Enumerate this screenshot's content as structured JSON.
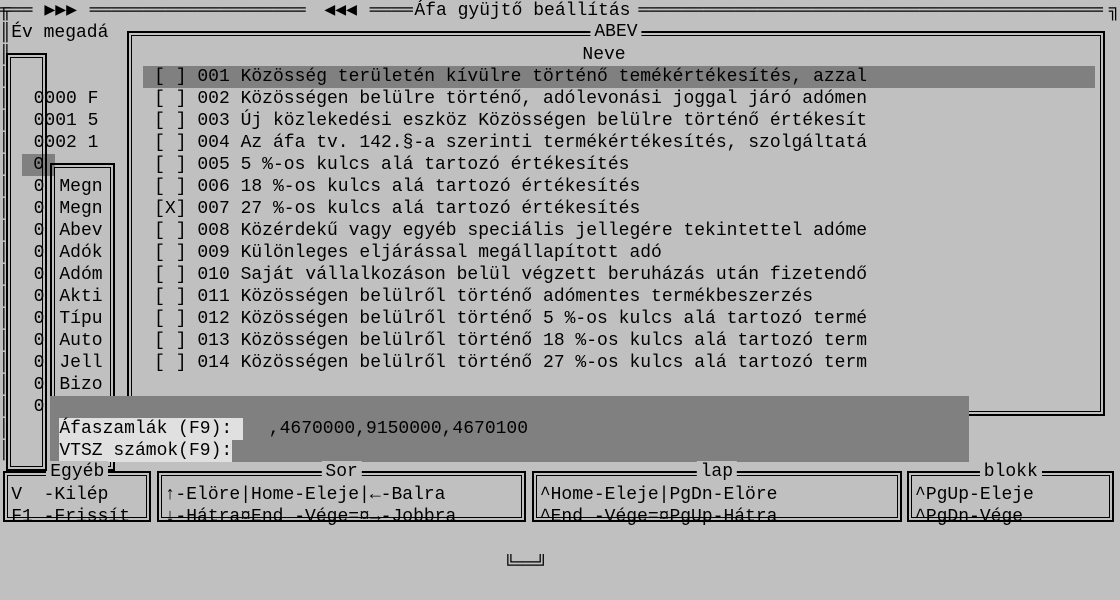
{
  "title_arrows_left": "▶▶▶",
  "title_arrows_right": "◀◀◀",
  "title_main": "Áfa gyüjtő beállítás",
  "field_label": "Év megadá",
  "abev_title": "ABEV",
  "neve_label": "Neve",
  "left_codes": [
    "0000 F",
    "0001 5",
    "0002 1"
  ],
  "left_highlight": "0",
  "left_zeros_count": 11,
  "mid_labels": [
    "Megn",
    "Megn",
    "Abev",
    "Adók",
    "Adóm",
    "Akti",
    "Típu",
    "Auto",
    "Jell",
    "Bizo"
  ],
  "afaszamlak_label": "Áfaszamlák (F9): ",
  "afaszamlak_value": ",4670000,9150000,4670100",
  "vtsz_label": "VTSZ számok(F9):",
  "items": [
    {
      "checked": false,
      "code": "001",
      "name": "Közösség területén kívülre történő temékértékesítés, azzal",
      "selected": true
    },
    {
      "checked": false,
      "code": "002",
      "name": "Közösségen belülre történő, adólevonási joggal járó adómen"
    },
    {
      "checked": false,
      "code": "003",
      "name": "Új közlekedési eszköz Közösségen belülre történő értékesít"
    },
    {
      "checked": false,
      "code": "004",
      "name": "Az áfa tv. 142.§-a szerinti termékértékesítés, szolgáltatá"
    },
    {
      "checked": false,
      "code": "005",
      "name": "5 %-os kulcs alá tartozó értékesítés"
    },
    {
      "checked": false,
      "code": "006",
      "name": "18 %-os kulcs alá tartozó értékesítés"
    },
    {
      "checked": true,
      "code": "007",
      "name": "27 %-os kulcs alá tartozó értékesítés"
    },
    {
      "checked": false,
      "code": "008",
      "name": "Közérdekű vagy egyéb speciális jellegére tekintettel adóme"
    },
    {
      "checked": false,
      "code": "009",
      "name": "Különleges eljárással megállapított adó"
    },
    {
      "checked": false,
      "code": "010",
      "name": "Saját vállalkozáson belül végzett beruházás után fizetendő"
    },
    {
      "checked": false,
      "code": "011",
      "name": "Közösségen belülről történő adómentes termékbeszerzés"
    },
    {
      "checked": false,
      "code": "012",
      "name": "Közösségen belülről történő 5 %-os kulcs alá tartozó termé"
    },
    {
      "checked": false,
      "code": "013",
      "name": "Közösségen belülről történő 18 %-os kulcs alá tartozó term"
    },
    {
      "checked": false,
      "code": "014",
      "name": "Közösségen belülről történő 27 %-os kulcs alá tartozó term"
    }
  ],
  "panels": {
    "egyeb": {
      "title": "Egyéb",
      "l1": "V  -Kilép",
      "l2": "F1 -Frissít"
    },
    "sor": {
      "title": "Sor",
      "l1": "↑-Elöre|Home-Eleje|←-Balra",
      "l2": "↓-Hátra¤End -Vége=¤→-Jobbra"
    },
    "lap": {
      "title": "lap",
      "l1": "^Home-Eleje|PgDn-Elöre",
      "l2": "^End -Vége=¤PgUp-Hátra"
    },
    "blokk": {
      "title": "blokk",
      "l1": "^PgUp-Eleje",
      "l2": "^PgDn-Vége"
    }
  },
  "cursor": "[_]"
}
